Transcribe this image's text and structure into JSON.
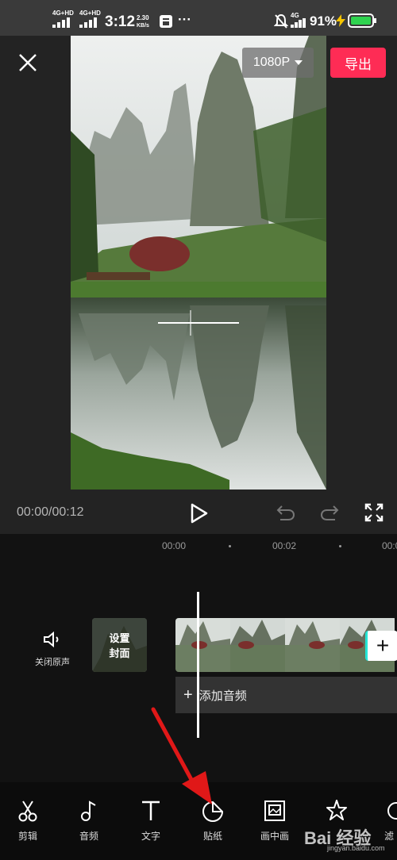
{
  "status_bar": {
    "signal1_label": "4G+HD",
    "signal2_label": "4G+HD",
    "time": "3:12",
    "speed_value": "2.30",
    "speed_unit": "KB/s",
    "more": "···",
    "network_right": "4G",
    "battery_percent": "91%"
  },
  "header": {
    "resolution_label": "1080P",
    "export_label": "导出"
  },
  "playback": {
    "time_display": "00:00/00:12"
  },
  "timeline": {
    "ruler_labels": [
      "00:00",
      "00:02",
      "00:0"
    ],
    "mute_label": "关闭原声",
    "cover_label_line1": "设置",
    "cover_label_line2": "封面",
    "add_audio_label": "添加音频",
    "add_clip_symbol": "+"
  },
  "toolbar": {
    "items": [
      {
        "label": "剪辑",
        "icon": "scissors-icon"
      },
      {
        "label": "音频",
        "icon": "music-note-icon"
      },
      {
        "label": "文字",
        "icon": "text-icon"
      },
      {
        "label": "贴纸",
        "icon": "sticker-icon"
      },
      {
        "label": "画中画",
        "icon": "picture-in-picture-icon"
      },
      {
        "label": "",
        "icon": "effects-icon"
      },
      {
        "label": "滤",
        "icon": "filter-icon"
      }
    ]
  },
  "watermark": {
    "text": "Bai 经验",
    "sub": "jingyan.baidu.com"
  },
  "colors": {
    "accent": "#fe2c55",
    "background": "#1a1a1a",
    "timeline_background": "#121212",
    "annotation_arrow": "#e01818"
  }
}
